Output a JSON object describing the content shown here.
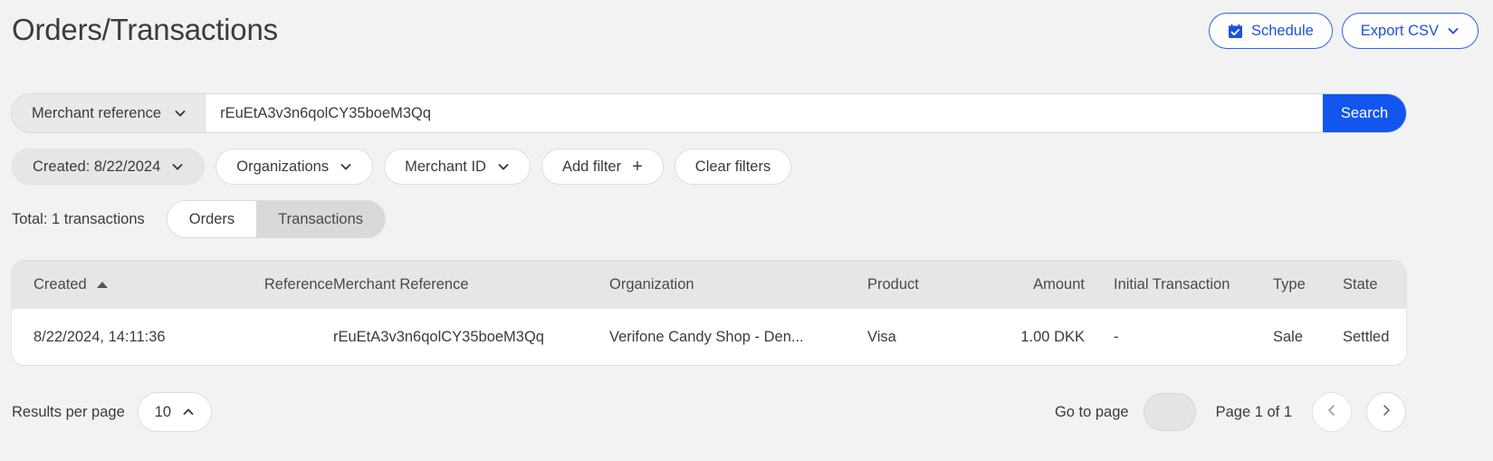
{
  "header": {
    "title": "Orders/Transactions",
    "schedule_label": "Schedule",
    "schedule_icon": "calendar-check-icon",
    "export_label": "Export CSV",
    "export_icon": "chevron-down-icon"
  },
  "search": {
    "field_label": "Merchant reference",
    "field_icon": "chevron-down-icon",
    "value": "rEuEtA3v3n6qolCY35boeM3Qq",
    "placeholder": "",
    "button_label": "Search"
  },
  "filters": {
    "chips": [
      {
        "label": "Created: 8/22/2024",
        "icon": "chevron-down-icon",
        "active": true
      },
      {
        "label": "Organizations",
        "icon": "chevron-down-icon",
        "active": false
      },
      {
        "label": "Merchant ID",
        "icon": "chevron-down-icon",
        "active": false
      },
      {
        "label": "Add filter",
        "icon": "plus-icon",
        "active": false
      },
      {
        "label": "Clear filters",
        "icon": "",
        "active": false
      }
    ]
  },
  "summary": {
    "total_label": "Total: 1 transactions",
    "tabs": [
      {
        "label": "Orders",
        "selected": true
      },
      {
        "label": "Transactions",
        "selected": false
      }
    ]
  },
  "table": {
    "sort_column": "Created",
    "sort_direction": "asc",
    "columns": [
      "Created",
      "Reference",
      "Merchant Reference",
      "Organization",
      "Product",
      "Amount",
      "Initial Transaction",
      "Type",
      "State"
    ],
    "rows": [
      {
        "created": "8/22/2024, 14:11:36",
        "reference": "",
        "merchant_reference": "rEuEtA3v3n6qolCY35boeM3Qq",
        "organization": "Verifone Candy Shop - Den...",
        "product": "Visa",
        "amount": "1.00 DKK",
        "initial_transaction": "-",
        "type": "Sale",
        "state": "Settled"
      }
    ]
  },
  "footer": {
    "results_per_page_label": "Results per page",
    "results_per_page_value": "10",
    "results_per_page_icon": "chevron-up-icon",
    "go_to_page_label": "Go to page",
    "go_to_page_value": "",
    "page_indicator": "Page 1 of 1",
    "prev_icon": "chevron-left-icon",
    "next_icon": "chevron-right-icon"
  },
  "colors": {
    "accent_blue": "#1256ee",
    "link_blue": "#1d51de",
    "page_bg": "#f2f2f2",
    "header_row_bg": "#e6e6e6"
  }
}
